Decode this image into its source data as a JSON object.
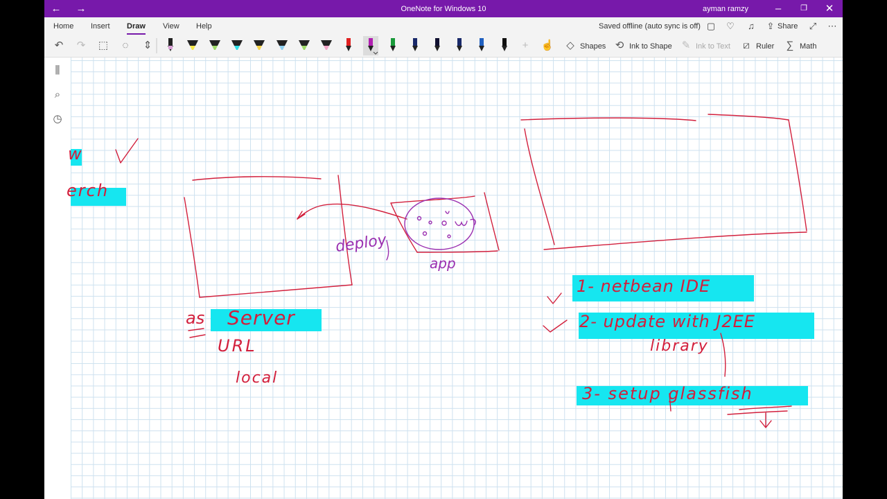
{
  "window": {
    "title": "OneNote for Windows 10",
    "user": "ayman ramzy",
    "accent": "#7719aa"
  },
  "menu": {
    "tabs": [
      {
        "label": "Home"
      },
      {
        "label": "Insert"
      },
      {
        "label": "Draw",
        "active": true
      },
      {
        "label": "View"
      },
      {
        "label": "Help"
      }
    ],
    "status": "Saved offline (auto sync is off)",
    "share_label": "Share"
  },
  "toolbar": {
    "shapes_label": "Shapes",
    "ink_to_shape_label": "Ink to Shape",
    "ink_to_text_label": "Ink to Text",
    "ruler_label": "Ruler",
    "math_label": "Math",
    "pens": [
      {
        "type": "pen",
        "color": "#d9a0d6"
      },
      {
        "type": "highlighter",
        "color": "#f5e94a"
      },
      {
        "type": "highlighter",
        "color": "#9ed96a"
      },
      {
        "type": "highlighter",
        "color": "#2fe0e8"
      },
      {
        "type": "highlighter",
        "color": "#f5d34a"
      },
      {
        "type": "highlighter",
        "color": "#8fd0f0"
      },
      {
        "type": "highlighter",
        "color": "#9ed96a"
      },
      {
        "type": "highlighter",
        "color": "#f2a6c8"
      },
      {
        "type": "pen",
        "color": "#e02020"
      },
      {
        "type": "pen",
        "color": "#b01fb0",
        "selected": true
      },
      {
        "type": "pen",
        "color": "#1a9a3a"
      },
      {
        "type": "pen",
        "color": "#1a2a6a"
      },
      {
        "type": "pen",
        "color": "#101030"
      },
      {
        "type": "pen",
        "color": "#1a2a6a"
      },
      {
        "type": "pen",
        "color": "#2060c0"
      },
      {
        "type": "pen",
        "color": "#101010"
      }
    ]
  },
  "nav": {
    "icons": [
      "notebooks-icon",
      "search-icon",
      "recent-icon"
    ]
  },
  "canvas": {
    "ink_color": "#d21f3c",
    "purple_ink": "#9a2fb0",
    "highlight_color": "#16e6f0",
    "notes": {
      "partial_1": "w",
      "partial_2": "erch",
      "deploy": "deploy",
      "app": "app",
      "as": "as",
      "server": "Server",
      "eq": "=",
      "url": "URL",
      "local": "local",
      "step1": "1- netbean IDE",
      "step2": "2- update with J2EE",
      "library": "library",
      "step3": "3- setup glassfish"
    }
  }
}
